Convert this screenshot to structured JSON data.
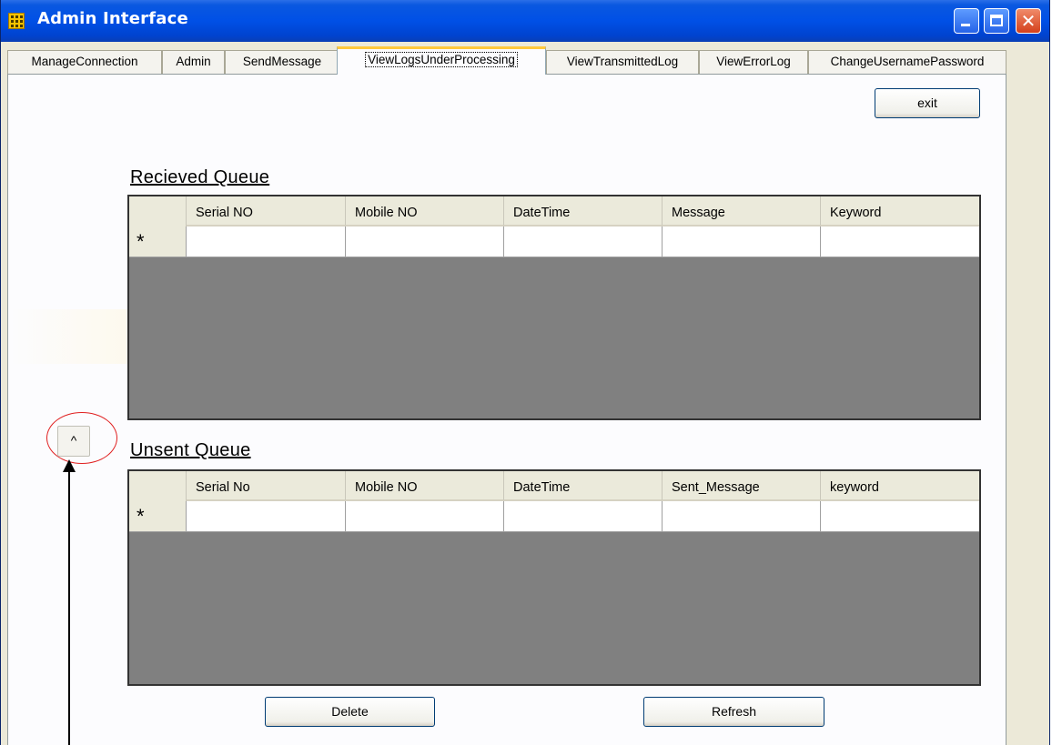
{
  "window": {
    "title": "Admin Interface"
  },
  "tabs": [
    {
      "label": "ManageConnection",
      "active": false
    },
    {
      "label": "Admin",
      "active": false
    },
    {
      "label": "SendMessage",
      "active": false
    },
    {
      "label": "ViewLogsUnderProcessing",
      "active": true
    },
    {
      "label": "ViewTransmittedLog",
      "active": false
    },
    {
      "label": "ViewErrorLog",
      "active": false
    },
    {
      "label": "ChangeUsernamePassword",
      "active": false
    }
  ],
  "exit_label": "exit",
  "received": {
    "title": "Recieved Queue",
    "columns": [
      "Serial NO",
      "Mobile NO",
      "DateTime",
      "Message",
      "Keyword"
    ],
    "new_row_marker": "*"
  },
  "unsent": {
    "title": "Unsent Queue",
    "columns": [
      "Serial No",
      "Mobile NO",
      "DateTime",
      "Sent_Message",
      "keyword"
    ],
    "new_row_marker": "*"
  },
  "collapse_button_label": "^",
  "delete_label": "Delete",
  "refresh_label": "Refresh",
  "colors": {
    "titlebar": "#0050e6",
    "window_bg": "#ece9d8",
    "grid_bg": "#808080",
    "active_tab_accent": "#ffc83c",
    "annotation": "#e02020"
  }
}
